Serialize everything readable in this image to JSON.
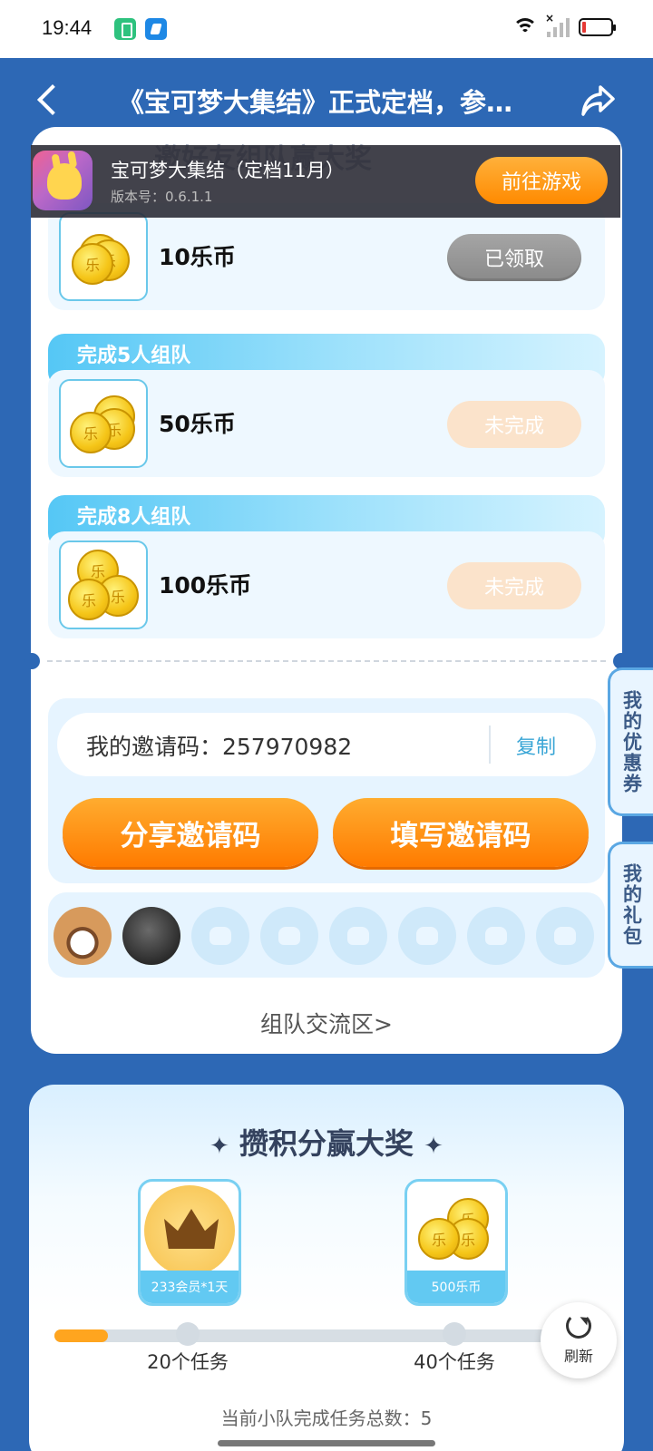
{
  "status_bar": {
    "time": "19:44"
  },
  "header": {
    "title": "《宝可梦大集结》正式定档，参…"
  },
  "game_banner": {
    "name": "宝可梦大集结（定档11月）",
    "version": "版本号：0.6.1.1",
    "button": "前往游戏"
  },
  "section_title_behind": "邀好友组队赢大奖",
  "rewards": [
    {
      "tier": "",
      "amount": "10乐币",
      "status": "已领取"
    },
    {
      "tier": "完成5人组队",
      "amount": "50乐币",
      "status": "未完成"
    },
    {
      "tier": "完成8人组队",
      "amount": "100乐币",
      "status": "未完成"
    }
  ],
  "invite": {
    "code_label": "我的邀请码：257970982",
    "copy": "复制",
    "share_button": "分享邀请码",
    "fill_button": "填写邀请码"
  },
  "team_link": "组队交流区>",
  "side_tabs": {
    "coupons": "我的优惠券",
    "gifts": "我的礼包"
  },
  "points": {
    "title": "攒积分赢大奖",
    "prizes": [
      {
        "label": "233会员*1天",
        "milestone": "20个任务"
      },
      {
        "label": "500乐币",
        "milestone": "40个任务"
      }
    ],
    "progress_completed": 5,
    "progress_max": 50,
    "total_tasks": "当前小队完成任务总数：5"
  },
  "refresh": "刷新"
}
